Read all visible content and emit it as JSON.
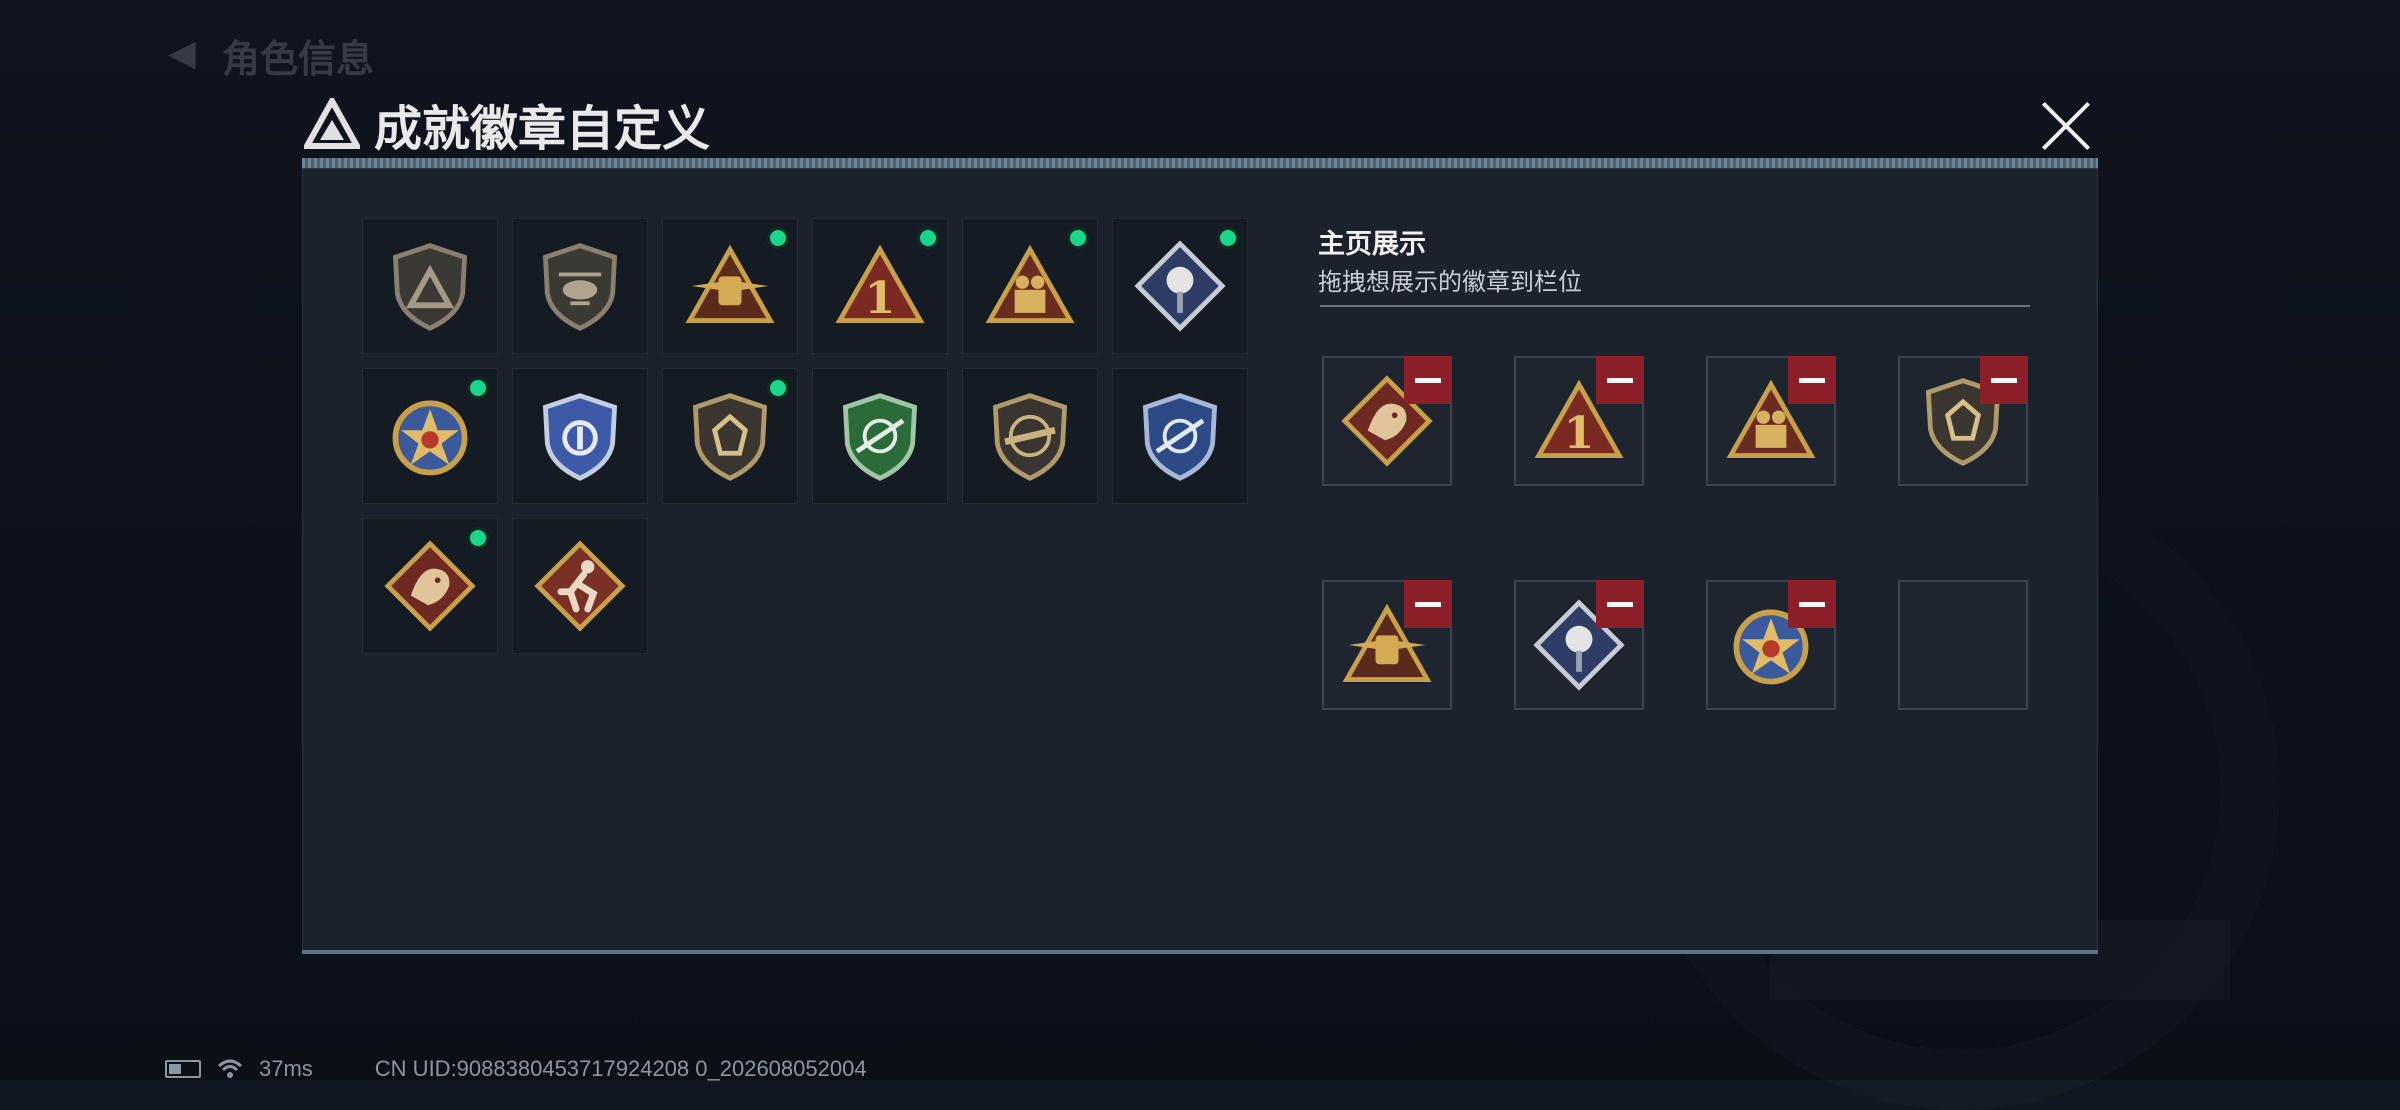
{
  "background": {
    "page_title": "角色信息"
  },
  "dialog": {
    "title": "成就徽章自定义"
  },
  "badges": [
    {
      "icon": "gray-shield-triangle-badge-icon",
      "new": false
    },
    {
      "icon": "helicopter-shield-badge-icon",
      "new": false
    },
    {
      "icon": "gold-winged-triangle-badge-icon",
      "new": true
    },
    {
      "icon": "red-number-one-triangle-badge-icon",
      "new": true
    },
    {
      "icon": "soldiers-triangle-badge-icon",
      "new": true
    },
    {
      "icon": "rose-diamond-badge-icon",
      "new": true
    },
    {
      "icon": "star-medal-badge-icon",
      "new": true
    },
    {
      "icon": "blue-police-badge-icon",
      "new": false
    },
    {
      "icon": "gem-shield-badge-icon",
      "new": true
    },
    {
      "icon": "green-crosshair-shield-badge-icon",
      "new": false
    },
    {
      "icon": "rifle-shield-badge-icon",
      "new": false
    },
    {
      "icon": "blue-crosshair-shield-badge-icon",
      "new": false
    },
    {
      "icon": "dragon-diamond-badge-icon",
      "new": true
    },
    {
      "icon": "runner-diamond-badge-icon",
      "new": false
    }
  ],
  "showcase": {
    "title": "主页展示",
    "subtitle": "拖拽想展示的徽章到栏位",
    "slots": [
      {
        "icon": "dragon-diamond-badge-icon"
      },
      {
        "icon": "red-number-one-triangle-badge-icon"
      },
      {
        "icon": "soldiers-triangle-badge-icon"
      },
      {
        "icon": "gem-shield-badge-icon"
      },
      {
        "icon": "gold-winged-triangle-badge-icon"
      },
      {
        "icon": "rose-diamond-badge-icon"
      },
      {
        "icon": "star-medal-badge-icon"
      },
      {
        "icon": ""
      }
    ]
  },
  "status": {
    "ping": "37ms",
    "uid": "CN UID:9088380453717924208 0_202608052004"
  },
  "colors": {
    "new_dot": "#19d68a",
    "remove": "#8c1f28",
    "gold": "#c9a04a",
    "red": "#7a2a22",
    "blue": "#2c4a8a",
    "green": "#2b6b3a"
  }
}
